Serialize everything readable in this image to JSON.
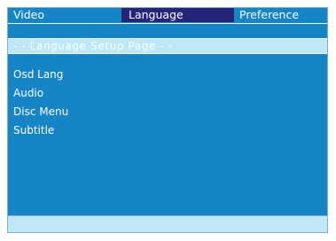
{
  "tabs": [
    {
      "label": "Video"
    },
    {
      "label": "Language"
    },
    {
      "label": "Preference"
    }
  ],
  "page_title": "- - Language  Setup  Page  - -",
  "menu_items": [
    {
      "label": "Osd Lang"
    },
    {
      "label": "Audio"
    },
    {
      "label": "Disc Menu"
    },
    {
      "label": "Subtitle"
    }
  ],
  "colors": {
    "panel": "#1585c7",
    "active_tab": "#26257a",
    "bar": "#bfe7f8"
  }
}
